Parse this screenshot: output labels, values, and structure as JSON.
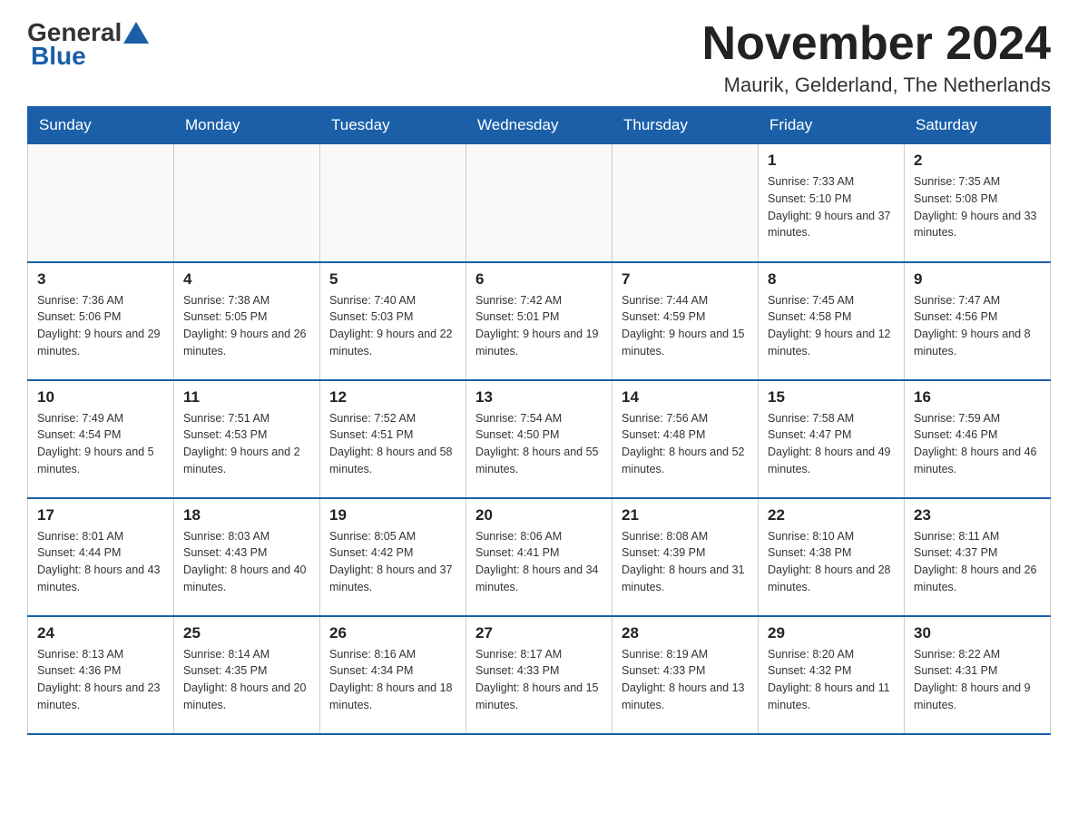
{
  "logo": {
    "general": "General",
    "blue": "Blue"
  },
  "header": {
    "month_title": "November 2024",
    "location": "Maurik, Gelderland, The Netherlands"
  },
  "weekdays": [
    "Sunday",
    "Monday",
    "Tuesday",
    "Wednesday",
    "Thursday",
    "Friday",
    "Saturday"
  ],
  "rows": [
    [
      {
        "day": "",
        "info": ""
      },
      {
        "day": "",
        "info": ""
      },
      {
        "day": "",
        "info": ""
      },
      {
        "day": "",
        "info": ""
      },
      {
        "day": "",
        "info": ""
      },
      {
        "day": "1",
        "info": "Sunrise: 7:33 AM\nSunset: 5:10 PM\nDaylight: 9 hours and 37 minutes."
      },
      {
        "day": "2",
        "info": "Sunrise: 7:35 AM\nSunset: 5:08 PM\nDaylight: 9 hours and 33 minutes."
      }
    ],
    [
      {
        "day": "3",
        "info": "Sunrise: 7:36 AM\nSunset: 5:06 PM\nDaylight: 9 hours and 29 minutes."
      },
      {
        "day": "4",
        "info": "Sunrise: 7:38 AM\nSunset: 5:05 PM\nDaylight: 9 hours and 26 minutes."
      },
      {
        "day": "5",
        "info": "Sunrise: 7:40 AM\nSunset: 5:03 PM\nDaylight: 9 hours and 22 minutes."
      },
      {
        "day": "6",
        "info": "Sunrise: 7:42 AM\nSunset: 5:01 PM\nDaylight: 9 hours and 19 minutes."
      },
      {
        "day": "7",
        "info": "Sunrise: 7:44 AM\nSunset: 4:59 PM\nDaylight: 9 hours and 15 minutes."
      },
      {
        "day": "8",
        "info": "Sunrise: 7:45 AM\nSunset: 4:58 PM\nDaylight: 9 hours and 12 minutes."
      },
      {
        "day": "9",
        "info": "Sunrise: 7:47 AM\nSunset: 4:56 PM\nDaylight: 9 hours and 8 minutes."
      }
    ],
    [
      {
        "day": "10",
        "info": "Sunrise: 7:49 AM\nSunset: 4:54 PM\nDaylight: 9 hours and 5 minutes."
      },
      {
        "day": "11",
        "info": "Sunrise: 7:51 AM\nSunset: 4:53 PM\nDaylight: 9 hours and 2 minutes."
      },
      {
        "day": "12",
        "info": "Sunrise: 7:52 AM\nSunset: 4:51 PM\nDaylight: 8 hours and 58 minutes."
      },
      {
        "day": "13",
        "info": "Sunrise: 7:54 AM\nSunset: 4:50 PM\nDaylight: 8 hours and 55 minutes."
      },
      {
        "day": "14",
        "info": "Sunrise: 7:56 AM\nSunset: 4:48 PM\nDaylight: 8 hours and 52 minutes."
      },
      {
        "day": "15",
        "info": "Sunrise: 7:58 AM\nSunset: 4:47 PM\nDaylight: 8 hours and 49 minutes."
      },
      {
        "day": "16",
        "info": "Sunrise: 7:59 AM\nSunset: 4:46 PM\nDaylight: 8 hours and 46 minutes."
      }
    ],
    [
      {
        "day": "17",
        "info": "Sunrise: 8:01 AM\nSunset: 4:44 PM\nDaylight: 8 hours and 43 minutes."
      },
      {
        "day": "18",
        "info": "Sunrise: 8:03 AM\nSunset: 4:43 PM\nDaylight: 8 hours and 40 minutes."
      },
      {
        "day": "19",
        "info": "Sunrise: 8:05 AM\nSunset: 4:42 PM\nDaylight: 8 hours and 37 minutes."
      },
      {
        "day": "20",
        "info": "Sunrise: 8:06 AM\nSunset: 4:41 PM\nDaylight: 8 hours and 34 minutes."
      },
      {
        "day": "21",
        "info": "Sunrise: 8:08 AM\nSunset: 4:39 PM\nDaylight: 8 hours and 31 minutes."
      },
      {
        "day": "22",
        "info": "Sunrise: 8:10 AM\nSunset: 4:38 PM\nDaylight: 8 hours and 28 minutes."
      },
      {
        "day": "23",
        "info": "Sunrise: 8:11 AM\nSunset: 4:37 PM\nDaylight: 8 hours and 26 minutes."
      }
    ],
    [
      {
        "day": "24",
        "info": "Sunrise: 8:13 AM\nSunset: 4:36 PM\nDaylight: 8 hours and 23 minutes."
      },
      {
        "day": "25",
        "info": "Sunrise: 8:14 AM\nSunset: 4:35 PM\nDaylight: 8 hours and 20 minutes."
      },
      {
        "day": "26",
        "info": "Sunrise: 8:16 AM\nSunset: 4:34 PM\nDaylight: 8 hours and 18 minutes."
      },
      {
        "day": "27",
        "info": "Sunrise: 8:17 AM\nSunset: 4:33 PM\nDaylight: 8 hours and 15 minutes."
      },
      {
        "day": "28",
        "info": "Sunrise: 8:19 AM\nSunset: 4:33 PM\nDaylight: 8 hours and 13 minutes."
      },
      {
        "day": "29",
        "info": "Sunrise: 8:20 AM\nSunset: 4:32 PM\nDaylight: 8 hours and 11 minutes."
      },
      {
        "day": "30",
        "info": "Sunrise: 8:22 AM\nSunset: 4:31 PM\nDaylight: 8 hours and 9 minutes."
      }
    ]
  ]
}
